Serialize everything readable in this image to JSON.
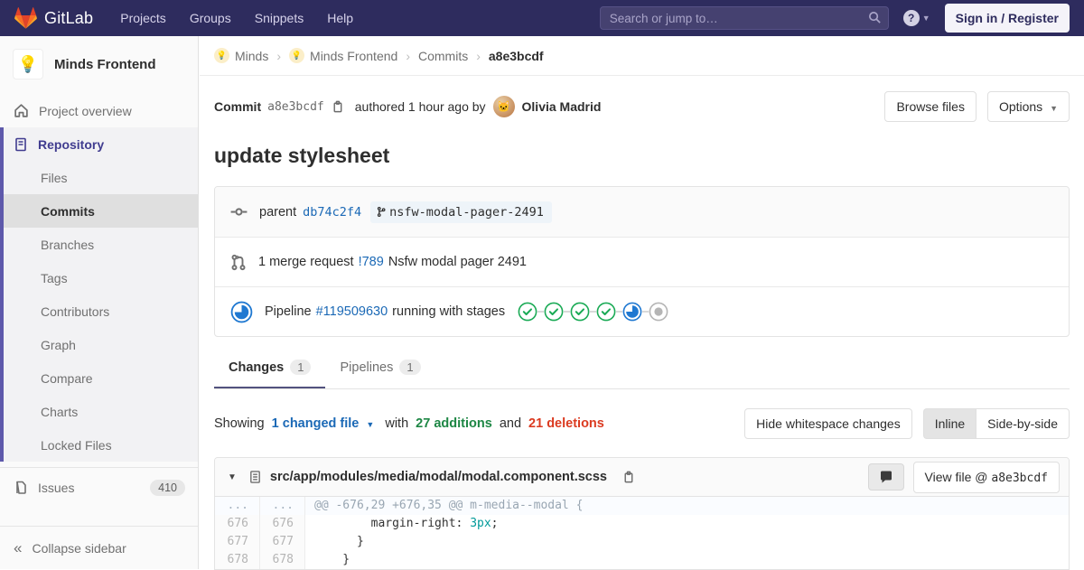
{
  "navbar": {
    "brand": "GitLab",
    "menu": [
      "Projects",
      "Groups",
      "Snippets",
      "Help"
    ],
    "search": {
      "placeholder": "Search or jump to…"
    },
    "help_icon": "?",
    "sign_in_label": "Sign in / Register"
  },
  "sidebar": {
    "project": {
      "name": "Minds Frontend",
      "avatar_emoji": "💡"
    },
    "overview_label": "Project overview",
    "repository_label": "Repository",
    "repository_items": [
      "Files",
      "Commits",
      "Branches",
      "Tags",
      "Contributors",
      "Graph",
      "Compare",
      "Charts",
      "Locked Files"
    ],
    "active_item": "Commits",
    "issues": {
      "label": "Issues",
      "count": "410"
    },
    "collapse_label": "Collapse sidebar"
  },
  "breadcrumb": {
    "items": [
      {
        "label": "Minds",
        "avatar": true
      },
      {
        "label": "Minds Frontend",
        "avatar": true
      },
      {
        "label": "Commits",
        "avatar": false
      },
      {
        "label": "a8e3bcdf",
        "avatar": false,
        "current": true
      }
    ]
  },
  "commit": {
    "label": "Commit",
    "sha": "a8e3bcdf",
    "authored_text": "authored 1 hour ago by",
    "author_name": "Olivia Madrid",
    "author_avatar_emoji": "🐱",
    "browse_files_label": "Browse files",
    "options_label": "Options",
    "title": "update stylesheet",
    "parent": {
      "label": "parent",
      "sha": "db74c2f4",
      "branch": "nsfw-modal-pager-2491"
    },
    "merge_request": {
      "count_text": "1 merge request",
      "id": "!789",
      "title": "Nsfw modal pager 2491"
    },
    "pipeline": {
      "label": "Pipeline",
      "id": "#119509630",
      "status_text": "running with stages",
      "stages": [
        "success",
        "success",
        "success",
        "success",
        "running",
        "created"
      ]
    }
  },
  "tabs": [
    {
      "label": "Changes",
      "count": "1",
      "active": true
    },
    {
      "label": "Pipelines",
      "count": "1",
      "active": false
    }
  ],
  "changes_summary": {
    "showing_label": "Showing",
    "changed_files": "1 changed file",
    "with_label": "with",
    "additions": "27 additions",
    "and_label": "and",
    "deletions": "21 deletions",
    "hide_whitespace_label": "Hide whitespace changes",
    "view_modes": [
      "Inline",
      "Side-by-side"
    ],
    "active_view_mode": "Inline"
  },
  "diff": {
    "file_path": "src/app/modules/media/modal/modal.component.scss",
    "view_file_label": "View file @",
    "view_file_sha": "a8e3bcdf",
    "lines": [
      {
        "old": "...",
        "new": "...",
        "type": "hunk",
        "parts": [
          {
            "text": "@@ -676,29 +676,35 @@ m-media--modal {"
          }
        ]
      },
      {
        "old": "676",
        "new": "676",
        "type": "context",
        "parts": [
          {
            "text": "        margin-right: "
          },
          {
            "text": "3px",
            "cls": "tok-num"
          },
          {
            "text": ";"
          }
        ]
      },
      {
        "old": "677",
        "new": "677",
        "type": "context",
        "parts": [
          {
            "text": "      }"
          }
        ]
      },
      {
        "old": "678",
        "new": "678",
        "type": "context",
        "parts": [
          {
            "text": "    }"
          }
        ]
      }
    ]
  },
  "colors": {
    "navbar_bg": "#2e2c5e",
    "link_blue": "#1b69b6",
    "success_green": "#1aaa55",
    "additions_green": "#1e8745",
    "deletions_red": "#db3b21",
    "running_blue": "#1f78d1",
    "active_indigo": "#5e59ab",
    "brand_orange": "#fc6d26"
  }
}
